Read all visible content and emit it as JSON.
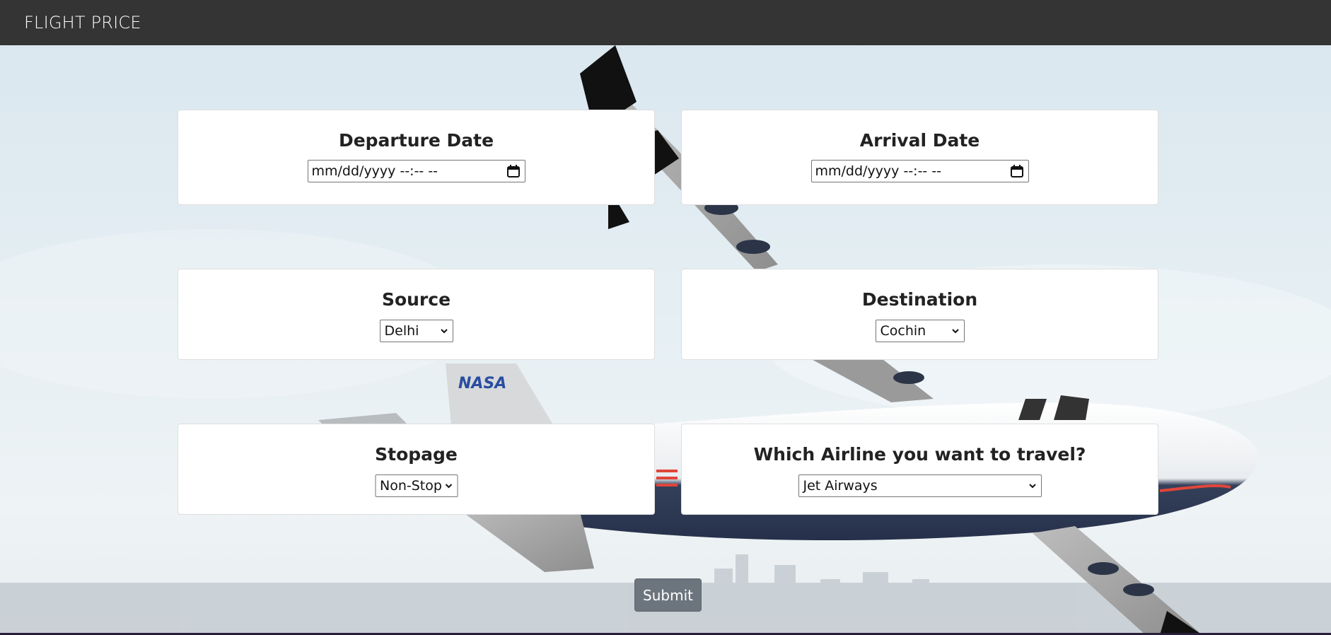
{
  "navbar": {
    "brand": "FLIGHT PRICE"
  },
  "background": {
    "tail_logo": "NASA"
  },
  "form": {
    "departure": {
      "label": "Departure Date",
      "placeholder": "mm/dd/yyyy --:-- --"
    },
    "arrival": {
      "label": "Arrival Date",
      "placeholder": "mm/dd/yyyy --:-- --"
    },
    "source": {
      "label": "Source",
      "selected": "Delhi"
    },
    "destination": {
      "label": "Destination",
      "selected": "Cochin"
    },
    "stopage": {
      "label": "Stopage",
      "selected": "Non-Stop"
    },
    "airline": {
      "label": "Which Airline you want to travel?",
      "selected": "Jet Airways"
    },
    "submit_label": "Submit"
  },
  "colors": {
    "navbar": "#343434",
    "submit": "#6c757d"
  }
}
